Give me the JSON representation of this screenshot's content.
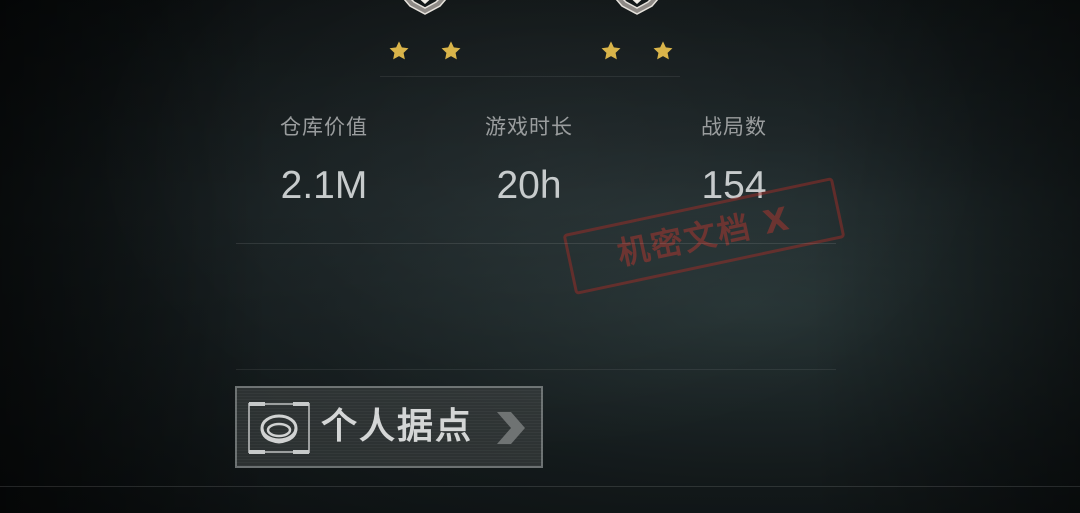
{
  "ranks": [
    {
      "stars": 2
    },
    {
      "stars": 2
    }
  ],
  "stats": [
    {
      "label": "仓库价值",
      "value": "2.1M"
    },
    {
      "label": "游戏时长",
      "value": "20h"
    },
    {
      "label": "战局数",
      "value": "154"
    }
  ],
  "stamp": {
    "text": "机密文档 X"
  },
  "base_button": {
    "label": "个人据点",
    "icon": "base-icon"
  },
  "colors": {
    "star": "#d9b44a",
    "stamp": "#a5372f",
    "text_label": "#9a9d9e",
    "text_value": "#c7cbcc"
  }
}
